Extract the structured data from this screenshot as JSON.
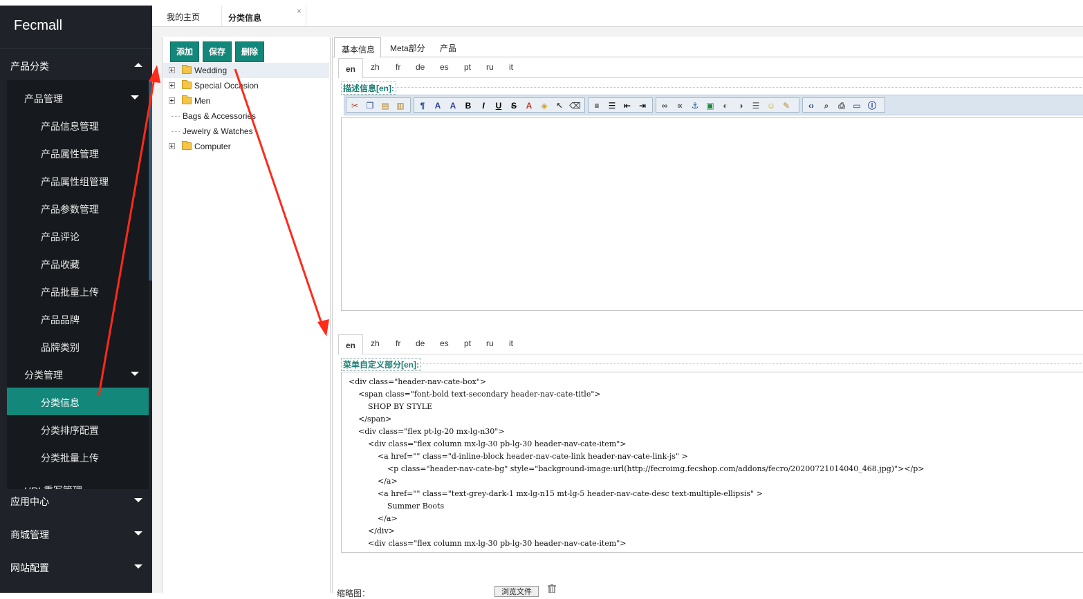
{
  "brand": "Fecmall",
  "sidebar": {
    "top_menu": {
      "label": "产品分类"
    },
    "groups": [
      {
        "label": "产品管理",
        "items": [
          "产品信息管理",
          "产品属性管理",
          "产品属性组管理",
          "产品参数管理",
          "产品评论",
          "产品收藏",
          "产品批量上传",
          "产品品牌",
          "品牌类别"
        ]
      },
      {
        "label": "分类管理",
        "items": [
          "分类信息",
          "分类排序配置",
          "分类批量上传"
        ]
      },
      {
        "label": "URL重写管理",
        "items": []
      }
    ],
    "active_item": "分类信息",
    "bottom_menus": [
      "应用中心",
      "商城管理",
      "网站配置"
    ]
  },
  "tabs": {
    "home": "我的主页",
    "current": "分类信息",
    "close": "×"
  },
  "tree": {
    "buttons": {
      "add": "添加",
      "save": "保存",
      "delete": "删除"
    },
    "nodes": [
      {
        "label": "Wedding",
        "folder": true
      },
      {
        "label": "Special Occasion",
        "folder": true
      },
      {
        "label": "Men",
        "folder": true
      },
      {
        "label": "Bags & Accessories",
        "folder": false
      },
      {
        "label": "Jewelry & Watches",
        "folder": false
      },
      {
        "label": "Computer",
        "folder": true
      }
    ]
  },
  "main_tabs": [
    "基本信息",
    "Meta部分",
    "产品"
  ],
  "lang_tabs": [
    "en",
    "zh",
    "fr",
    "de",
    "es",
    "pt",
    "ru",
    "it"
  ],
  "desc_legend": "描述信息[en]:",
  "menu_legend": "菜单自定义部分[en]:",
  "required_mark": "*",
  "code_lines": [
    "<div class=\"header-nav-cate-box\">",
    "    <span class=\"font-bold text-secondary header-nav-cate-title\">",
    "        SHOP BY STYLE",
    "    </span>",
    "    <div class=\"flex pt-lg-20 mx-lg-n30\">",
    "        <div class=\"flex column mx-lg-30 pb-lg-30 header-nav-cate-item\">",
    "            <a href=\"\" class=\"d-inline-block header-nav-cate-link header-nav-cate-link-js\" >",
    "                <p class=\"header-nav-cate-bg\" style=\"background-image:url(http://fecroimg.fecshop.com/addons/fecro/20200721014040_468.jpg)\"></p>",
    "            </a>",
    "            <a href=\"\" class=\"text-grey-dark-1 mx-lg-n15 mt-lg-5 header-nav-cate-desc text-multiple-ellipsis\" >",
    "                Summer Boots",
    "            </a>",
    "        </div>",
    "        <div class=\"flex column mx-lg-30 pb-lg-30 header-nav-cate-item\">"
  ],
  "thumb_label": "缩略图：",
  "browse_button": "浏览文件",
  "colors": {
    "sidebar_bg": "#1f2329",
    "active_green": "#13877a",
    "annotation_red": "#ff2a1a"
  }
}
